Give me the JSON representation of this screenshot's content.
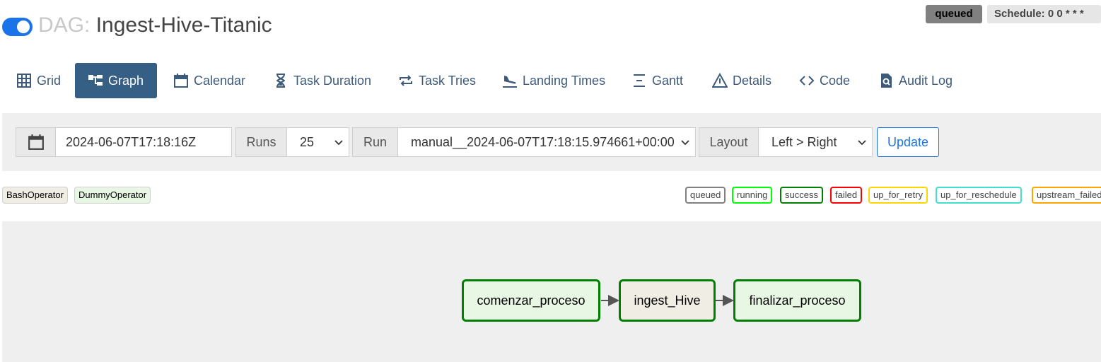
{
  "header": {
    "dag_prefix": "DAG:",
    "dag_name": "Ingest-Hive-Titanic",
    "state_badge": "queued",
    "schedule_badge": "Schedule: 0 0 * * *"
  },
  "tabs": [
    {
      "label": "Grid",
      "icon": "grid-icon"
    },
    {
      "label": "Graph",
      "icon": "graph-icon",
      "active": true
    },
    {
      "label": "Calendar",
      "icon": "calendar-icon"
    },
    {
      "label": "Task Duration",
      "icon": "hourglass-icon"
    },
    {
      "label": "Task Tries",
      "icon": "repeat-icon"
    },
    {
      "label": "Landing Times",
      "icon": "plane-landing-icon"
    },
    {
      "label": "Gantt",
      "icon": "gantt-icon"
    },
    {
      "label": "Details",
      "icon": "warning-triangle-icon"
    },
    {
      "label": "Code",
      "icon": "code-icon"
    },
    {
      "label": "Audit Log",
      "icon": "file-search-icon"
    }
  ],
  "controls": {
    "date_value": "2024-06-07T17:18:16Z",
    "runs_label": "Runs",
    "runs_value": "25",
    "run_label": "Run",
    "run_value": "manual__2024-06-07T17:18:15.974661+00:00",
    "layout_label": "Layout",
    "layout_value": "Left > Right",
    "update_label": "Update"
  },
  "operators": [
    {
      "label": "BashOperator",
      "color": "#f0ede4"
    },
    {
      "label": "DummyOperator",
      "color": "#e8f7e4"
    }
  ],
  "states": [
    {
      "label": "queued",
      "color": "#808080"
    },
    {
      "label": "running",
      "color": "#00ff00"
    },
    {
      "label": "success",
      "color": "#008000"
    },
    {
      "label": "failed",
      "color": "#ff0000"
    },
    {
      "label": "up_for_retry",
      "color": "#ffd700"
    },
    {
      "label": "up_for_reschedule",
      "color": "#40e0d0"
    },
    {
      "label": "upstream_failed",
      "color": "#ffa500"
    }
  ],
  "graph": {
    "nodes": [
      {
        "label": "comenzar_proceso",
        "operator": "DummyOperator",
        "state": "success"
      },
      {
        "label": "ingest_Hive",
        "operator": "BashOperator",
        "state": "success"
      },
      {
        "label": "finalizar_proceso",
        "operator": "DummyOperator",
        "state": "success"
      }
    ]
  }
}
